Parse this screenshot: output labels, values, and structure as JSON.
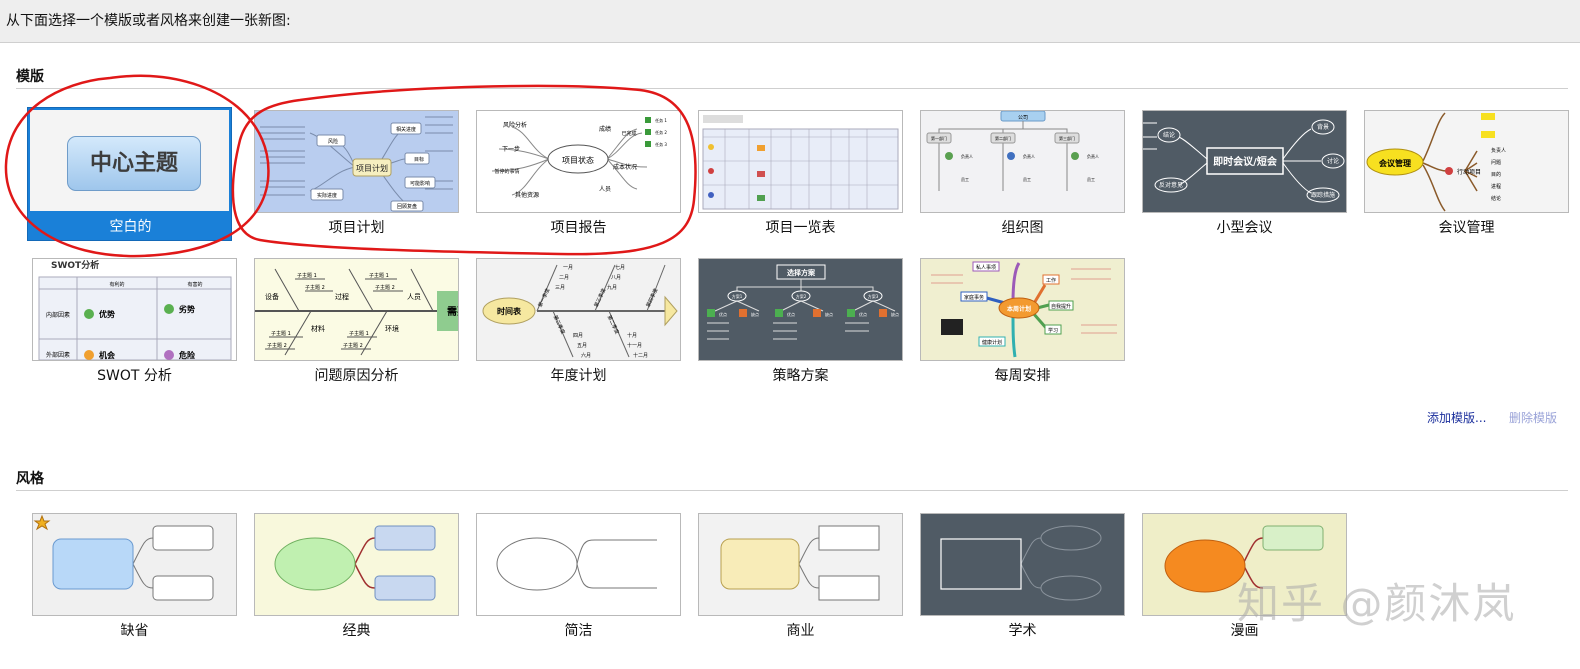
{
  "header": {
    "prompt": "从下面选择一个模版或者风格来创建一张新图:"
  },
  "templates_section": {
    "title": "模版",
    "blank_topic_text": "中心主题",
    "items": [
      {
        "label": "空白的",
        "selected": true
      },
      {
        "label": "项目计划",
        "selected": false
      },
      {
        "label": "项目报告",
        "selected": false
      },
      {
        "label": "项目一览表",
        "selected": false
      },
      {
        "label": "组织图",
        "selected": false
      },
      {
        "label": "小型会议",
        "selected": false
      },
      {
        "label": "会议管理",
        "selected": false
      },
      {
        "label": "SWOT 分析",
        "selected": false
      },
      {
        "label": "问题原因分析",
        "selected": false
      },
      {
        "label": "年度计划",
        "selected": false
      },
      {
        "label": "策略方案",
        "selected": false
      },
      {
        "label": "每周安排",
        "selected": false
      }
    ],
    "thumbnails": {
      "project_plan": {
        "center": "项目计划",
        "n1": "风险",
        "n2": "相关进度",
        "n3": "目标",
        "n4": "可能影响",
        "n5": "实际进度",
        "n6": "回顾复盘"
      },
      "project_report": {
        "center": "项目状态",
        "n1": "风险分析",
        "n2": "下一步",
        "n3": "暂停的事情",
        "n4": "其他资源",
        "n5": "成绩",
        "n6": "已完成",
        "n7": "成本状况",
        "n8": "人员",
        "n9": "任务 1",
        "n10": "任务 2",
        "n11": "任务 3"
      },
      "meeting": {
        "center": "即时会议/短会",
        "n1": "结论",
        "n2": "背景",
        "n3": "讨论",
        "n4": "反对意见",
        "n5": "跟踪措施"
      },
      "meeting_mgmt": {
        "center": "会议管理",
        "n1": "行动项目",
        "n2": "负责人",
        "n3": "问题",
        "n4": "目的",
        "n5": "进程",
        "n6": "结论"
      },
      "swot": {
        "title": "SWOT分析",
        "h1": "有利的",
        "h2": "有害的",
        "r1": "内部因素",
        "r2": "外部因素",
        "c1": "优势",
        "c2": "劣势",
        "c3": "机会",
        "c4": "危险"
      },
      "fishbone": {
        "head": "需要",
        "b1": "设备",
        "b2": "过程",
        "b3": "人员",
        "b4": "材料",
        "b5": "环境",
        "s1": "子主题 1",
        "s2": "子主题 2"
      },
      "annual": {
        "head": "时间表",
        "m1": "一月",
        "m2": "二月",
        "m3": "三月",
        "m4": "七月",
        "m5": "八月",
        "m6": "九月",
        "m7": "四月",
        "m8": "五月",
        "m9": "六月",
        "m10": "十月",
        "m11": "十一月",
        "m12": "十二月",
        "q1": "第一季度",
        "q2": "第二季度",
        "q3": "第三季度",
        "q4": "第四季度"
      },
      "strategy": {
        "title": "选择方案",
        "a": "方案1",
        "b": "方案2",
        "c": "方案3",
        "pro": "优点",
        "con": "缺点"
      },
      "weekly": {
        "center": "本周计划",
        "n1": "私人事项",
        "n2": "家庭事务",
        "n4": "健康计划",
        "n5": "工作",
        "n6": "自我提升",
        "n7": "学习"
      },
      "org": {
        "top": "公司",
        "d1": "第一部门",
        "d2": "第二部门",
        "d3": "第三部门",
        "p": "负责人",
        "e": "员工"
      }
    }
  },
  "links": {
    "add_template": "添加模版...",
    "delete_template": "删除模版"
  },
  "styles_section": {
    "title": "风格",
    "items": [
      {
        "label": "缺省"
      },
      {
        "label": "经典"
      },
      {
        "label": "简洁"
      },
      {
        "label": "商业"
      },
      {
        "label": "学术"
      },
      {
        "label": "漫画"
      }
    ]
  },
  "watermark": "知乎 @颜沐岚",
  "colors": {
    "selection_blue": "#1a80d8",
    "annotation_red": "#e01818",
    "link_blue": "#1b2f9c",
    "disabled_link": "#9aa3d8",
    "academic_bg": "#505b65",
    "blueprint_bg": "#b9cdef"
  }
}
